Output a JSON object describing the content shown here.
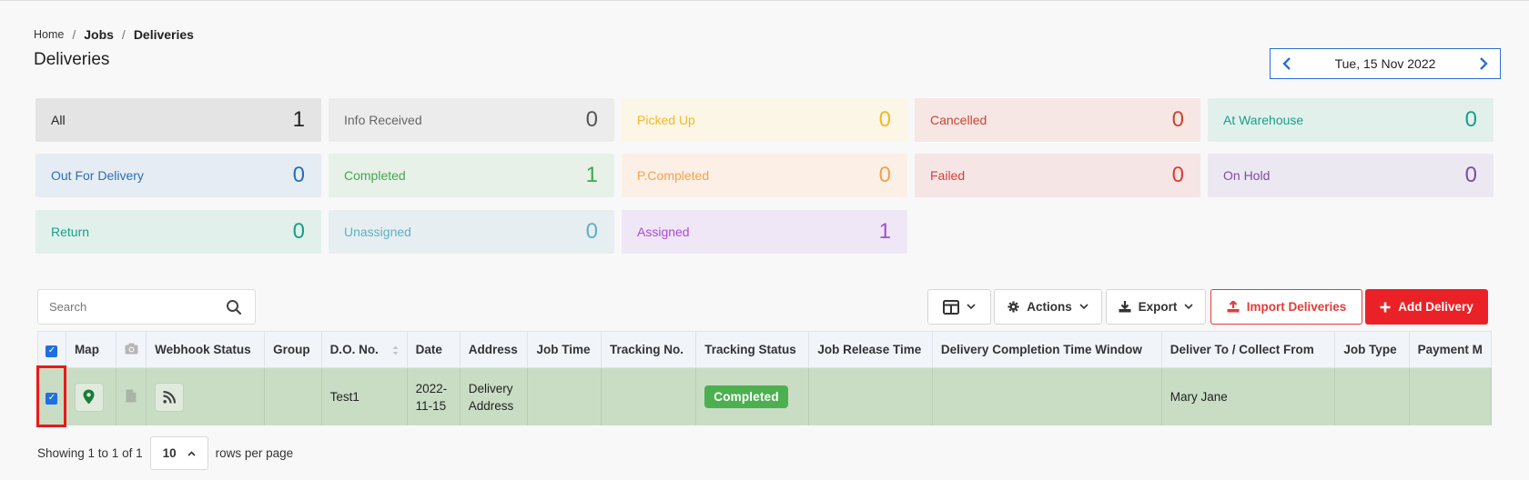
{
  "breadcrumb": {
    "home": "Home",
    "jobs": "Jobs",
    "current": "Deliveries",
    "sep": "/"
  },
  "page_title": "Deliveries",
  "date_nav": {
    "date": "Tue, 15 Nov 2022"
  },
  "status_cards": [
    {
      "label": "All",
      "count": "1",
      "bg": "#e4e4e4",
      "label_color": "#222",
      "count_color": "#222"
    },
    {
      "label": "Info Received",
      "count": "0",
      "bg": "#ececec",
      "label_color": "#666",
      "count_color": "#555"
    },
    {
      "label": "Picked Up",
      "count": "0",
      "bg": "#fcf6e7",
      "label_color": "#f4b826",
      "count_color": "#f4b826"
    },
    {
      "label": "Cancelled",
      "count": "0",
      "bg": "#f6e7e5",
      "label_color": "#c9442f",
      "count_color": "#c9442f"
    },
    {
      "label": "At Warehouse",
      "count": "0",
      "bg": "#e2f0ec",
      "label_color": "#17a089",
      "count_color": "#17a089"
    },
    {
      "label": "Out For Delivery",
      "count": "0",
      "bg": "#e6ecf3",
      "label_color": "#2a6fb6",
      "count_color": "#2a6fb6"
    },
    {
      "label": "Completed",
      "count": "1",
      "bg": "#e7f1e8",
      "label_color": "#43a64f",
      "count_color": "#43a64f"
    },
    {
      "label": "P.Completed",
      "count": "0",
      "bg": "#fcf0e6",
      "label_color": "#f2a24b",
      "count_color": "#f2a24b"
    },
    {
      "label": "Failed",
      "count": "0",
      "bg": "#f6e5e5",
      "label_color": "#de3b36",
      "count_color": "#de3b36"
    },
    {
      "label": "On Hold",
      "count": "0",
      "bg": "#ece8f1",
      "label_color": "#7f4ba3",
      "count_color": "#7f4ba3"
    },
    {
      "label": "Return",
      "count": "0",
      "bg": "#e2f0ec",
      "label_color": "#17a089",
      "count_color": "#17a089"
    },
    {
      "label": "Unassigned",
      "count": "0",
      "bg": "#e7eef1",
      "label_color": "#5fb0c4",
      "count_color": "#5fb0c4"
    },
    {
      "label": "Assigned",
      "count": "1",
      "bg": "#f0e7f6",
      "label_color": "#a94bd8",
      "count_color": "#a94bd8"
    }
  ],
  "toolbar": {
    "search_placeholder": "Search",
    "actions_label": "Actions",
    "export_label": "Export",
    "import_label": "Import Deliveries",
    "add_label": "Add Delivery"
  },
  "table": {
    "headers": [
      "Map",
      "Webhook Status",
      "Group",
      "D.O. No.",
      "Date",
      "Address",
      "Job Time",
      "Tracking No.",
      "Tracking Status",
      "Job Release Time",
      "Delivery Completion Time Window",
      "Deliver To / Collect From",
      "Job Type",
      "Payment M"
    ],
    "rows": [
      {
        "group": "",
        "do_no": "Test1",
        "date_line1": "2022-",
        "date_line2": "11-15",
        "address_line1": "Delivery",
        "address_line2": "Address",
        "job_time": "",
        "tracking_no": "",
        "tracking_status": "Completed",
        "job_release_time": "",
        "completion_window": "",
        "deliver_to": "Mary Jane",
        "job_type": "",
        "payment": ""
      }
    ]
  },
  "pagination": {
    "showing": "Showing 1 to 1 of 1",
    "per_page": "10",
    "suffix": "rows per page"
  }
}
